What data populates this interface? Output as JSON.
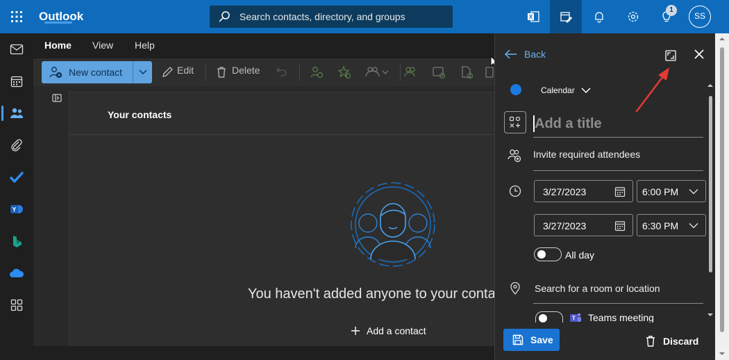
{
  "app": {
    "title": "Outlook",
    "avatar_initials": "SS",
    "notification_count": "1"
  },
  "search": {
    "placeholder": "Search contacts, directory, and groups"
  },
  "topbar": {
    "icons": [
      "excel-icon",
      "edit-calendar-icon",
      "bell-icon",
      "gear-icon",
      "lightbulb-icon"
    ]
  },
  "rail": {
    "items": [
      "mail-icon",
      "calendar-icon",
      "people-icon",
      "paperclip-icon",
      "todo-icon",
      "yammer-icon",
      "bookings-icon",
      "onedrive-icon",
      "more-apps-icon"
    ]
  },
  "ribbon": {
    "tabs": [
      {
        "label": "Home"
      },
      {
        "label": "View"
      },
      {
        "label": "Help"
      }
    ],
    "new_contact": "New contact",
    "edit": "Edit",
    "delete": "Delete"
  },
  "contacts": {
    "header": "Your contacts",
    "empty_message": "You haven't added anyone to your conta",
    "add_contact": "Add a contact"
  },
  "event_panel": {
    "back": "Back",
    "calendar_label": "Calendar",
    "calendar_color": "#1a7ae0",
    "title_placeholder": "Add a title",
    "attendees_placeholder": "Invite required attendees",
    "start_date": "3/27/2023",
    "start_time": "6:00 PM",
    "end_date": "3/27/2023",
    "end_time": "6:30 PM",
    "all_day": "All day",
    "all_day_on": false,
    "location_placeholder": "Search for a room or location",
    "teams_meeting": "Teams meeting",
    "teams_on": false,
    "save": "Save",
    "discard": "Discard"
  },
  "colors": {
    "brand": "#0f6cbd",
    "accent": "#4a9eea",
    "annotation_arrow": "#e53935"
  }
}
